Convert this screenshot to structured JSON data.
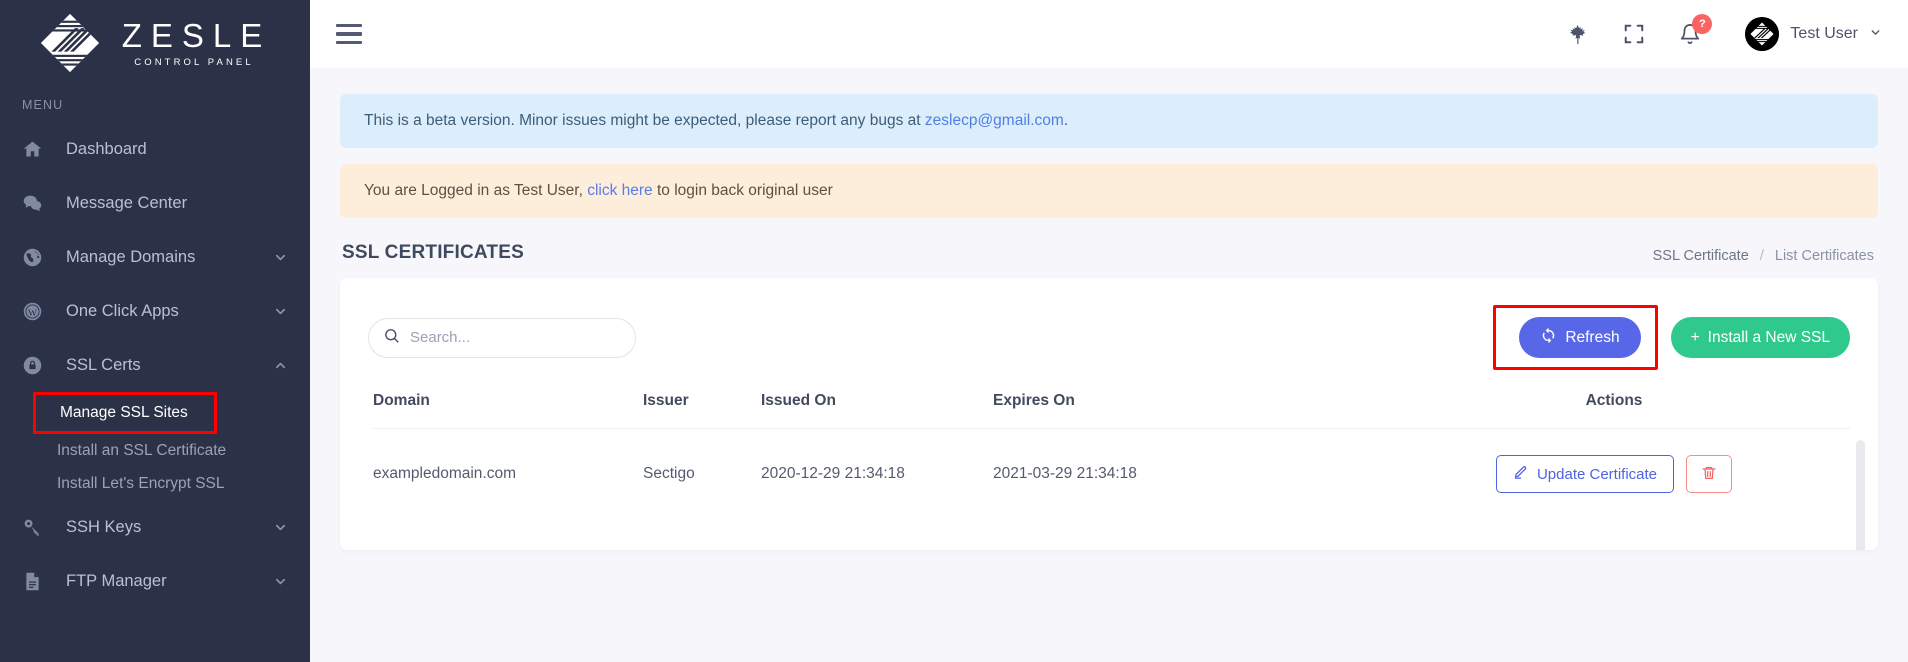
{
  "brand": {
    "title": "ZESLE",
    "subtitle": "CONTROL PANEL",
    "logo_icon": "zesle-diamond-logo"
  },
  "sidebar": {
    "menu_label": "MENU",
    "items": [
      {
        "label": "Dashboard",
        "icon": "home-icon",
        "expandable": false
      },
      {
        "label": "Message Center",
        "icon": "chat-bubbles-icon",
        "expandable": false
      },
      {
        "label": "Manage Domains",
        "icon": "globe-icon",
        "expandable": true
      },
      {
        "label": "One Click Apps",
        "icon": "wordpress-icon",
        "expandable": true
      },
      {
        "label": "SSL Certs",
        "icon": "lock-icon",
        "expandable": true,
        "expanded": true
      },
      {
        "label": "SSH Keys",
        "icon": "key-icon",
        "expandable": true
      },
      {
        "label": "FTP Manager",
        "icon": "file-icon",
        "expandable": true
      }
    ],
    "ssl_subitems": [
      {
        "label": "Manage SSL Sites",
        "active": true,
        "highlighted": true
      },
      {
        "label": "Install an SSL Certificate",
        "active": false,
        "highlighted": false
      },
      {
        "label": "Install Let's Encrypt SSL",
        "active": false,
        "highlighted": false
      }
    ]
  },
  "topbar": {
    "hamburger_icon": "hamburger-menu-icon",
    "language_icon": "maple-leaf-icon",
    "fullscreen_icon": "fullscreen-icon",
    "notifications_icon": "bell-icon",
    "notifications_badge": "?",
    "avatar_icon": "user-avatar",
    "user_name": "Test User",
    "user_caret_icon": "chevron-down-icon"
  },
  "alerts": {
    "beta": {
      "text_before": "This is a beta version. Minor issues might be expected, please report any bugs at ",
      "link": "zeslecp@gmail.com",
      "text_after": "."
    },
    "impersonate": {
      "text_before": "You are Logged in as Test User, ",
      "link": "click here",
      "text_after": " to login back original user"
    }
  },
  "page": {
    "title": "SSL CERTIFICATES",
    "breadcrumb_parent": "SSL Certificate",
    "breadcrumb_sep": "/",
    "breadcrumb_current": "List Certificates"
  },
  "toolbar": {
    "search_placeholder": "Search...",
    "search_value": "",
    "search_icon": "search-icon",
    "refresh_label": "Refresh",
    "refresh_icon": "refresh-icon",
    "install_label": "Install a New SSL",
    "install_icon": "plus-icon"
  },
  "table": {
    "columns": [
      "Domain",
      "Issuer",
      "Issued On",
      "Expires On",
      "Actions"
    ],
    "rows": [
      {
        "domain": "exampledomain.com",
        "issuer": "Sectigo",
        "issued_on": "2020-12-29 21:34:18",
        "expires_on": "2021-03-29 21:34:18",
        "update_label": "Update Certificate",
        "update_icon": "pencil-icon",
        "delete_icon": "trash-icon"
      }
    ]
  },
  "colors": {
    "sidebar_bg": "#2b3147",
    "accent_blue": "#5867e8",
    "accent_green": "#2fc98c",
    "danger_red": "#f56565",
    "highlight_box": "#ff0000",
    "info_bg": "#dceefc",
    "warn_bg": "#fdeedb"
  }
}
